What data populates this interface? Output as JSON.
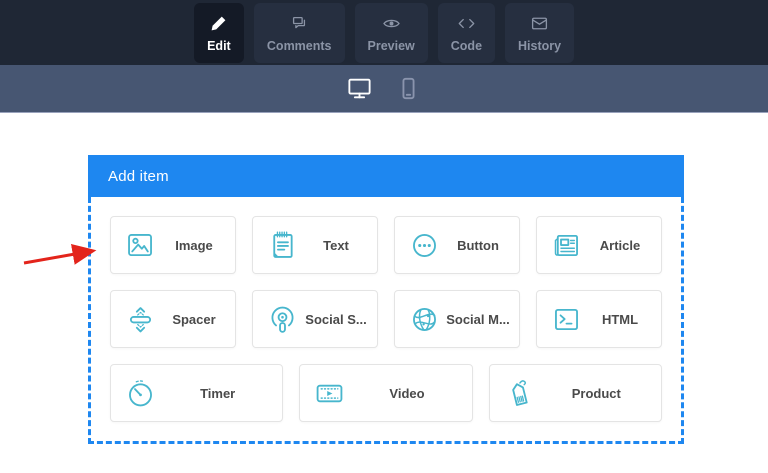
{
  "colors": {
    "toolbar_bg": "#1f2735",
    "toolbar_button_bg": "#262f40",
    "toolbar_button_active_bg": "#141a26",
    "toolbar_text": "#8b94a6",
    "device_bar_bg": "#475672",
    "accent_blue": "#1e87f0",
    "icon_teal": "#47b6cd",
    "card_border": "#e4e4e4",
    "card_label": "#4a4a4a",
    "arrow_red": "#e3241b"
  },
  "toolbar": {
    "buttons": [
      {
        "label": "Edit",
        "icon": "pencil-icon",
        "active": true
      },
      {
        "label": "Comments",
        "icon": "comments-icon",
        "active": false
      },
      {
        "label": "Preview",
        "icon": "eye-icon",
        "active": false
      },
      {
        "label": "Code",
        "icon": "code-icon",
        "active": false
      },
      {
        "label": "History",
        "icon": "history-icon",
        "active": false
      }
    ]
  },
  "device_bar": {
    "modes": [
      {
        "name": "desktop",
        "icon": "desktop-icon",
        "active": true
      },
      {
        "name": "mobile",
        "icon": "mobile-icon",
        "active": false
      }
    ]
  },
  "panel": {
    "title": "Add item",
    "items": [
      {
        "label": "Image",
        "icon": "image-icon"
      },
      {
        "label": "Text",
        "icon": "text-icon"
      },
      {
        "label": "Button",
        "icon": "button-icon"
      },
      {
        "label": "Article",
        "icon": "article-icon"
      },
      {
        "label": "Spacer",
        "icon": "spacer-icon"
      },
      {
        "label": "Social S...",
        "icon": "social-share-icon"
      },
      {
        "label": "Social M...",
        "icon": "social-media-icon"
      },
      {
        "label": "HTML",
        "icon": "html-icon"
      },
      {
        "label": "Timer",
        "icon": "timer-icon"
      },
      {
        "label": "Video",
        "icon": "video-icon"
      },
      {
        "label": "Product",
        "icon": "product-icon"
      }
    ]
  },
  "annotation": {
    "arrow_points_to": "Image item",
    "arrow_color": "#e3241b"
  }
}
